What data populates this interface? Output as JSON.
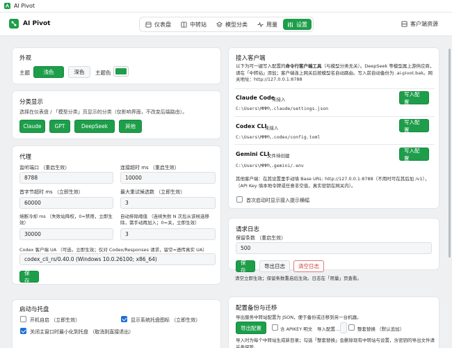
{
  "window": {
    "title": "AI Pivot"
  },
  "brand": {
    "name": "AI Pivot"
  },
  "nav": {
    "tabs": [
      {
        "label": "仪表盘",
        "icon": "dashboard-icon"
      },
      {
        "label": "中转站",
        "icon": "relay-icon"
      },
      {
        "label": "模型分类",
        "icon": "layers-icon"
      },
      {
        "label": "用量",
        "icon": "activity-icon"
      },
      {
        "label": "设置",
        "icon": "sliders-icon",
        "active": true
      }
    ]
  },
  "header_right": {
    "label": "客户端资源"
  },
  "appearance": {
    "title": "外观",
    "theme_label": "主题",
    "light": "浅色",
    "dark": "深色",
    "accent_label": "主题色",
    "accent_color": "#1e9e4a"
  },
  "categories": {
    "title": "分类显示",
    "desc": "选择在仪表盘 / 「模型分类」页显示的分类（仅影响界面，不改变后端路由）。",
    "items": [
      "Claude",
      "GPT",
      "DeepSeek",
      "其他"
    ]
  },
  "proxy": {
    "title": "代理",
    "port_label": "监听端口 （重启生效）",
    "port_value": "8788",
    "connect_timeout_label": "连接超时 ms （重启生效）",
    "connect_timeout_value": "10000",
    "first_byte_label": "首字节超时 ms （立即生效）",
    "first_byte_value": "60000",
    "max_retry_label": "最大重试候选数 （立即生效）",
    "max_retry_value": "3",
    "breaker_label": "熔断冷却 ms （失败站降权，0=禁用，立即生效）",
    "breaker_value": "30000",
    "auto_remove_label": "自动排除阈值 （连续失败 N 次后从该候选移除，需手动再加入；0=关，立即生效）",
    "auto_remove_value": "3",
    "ua_label": "Codex 客户端 UA （可选，立即生效；仅对 Codex/Responses 请求，留空=透传真实 UA）",
    "ua_value": "codex_cli_rs/0.40.0 (Windows 10.0.26100; x86_64)",
    "save": "保存"
  },
  "startup": {
    "title": "启动与托盘",
    "autostart": "开机自启 （立即生效）",
    "autostart_checked": false,
    "tray_icon": "显示系统托盘图标 （立即生效）",
    "tray_icon_checked": true,
    "close_minimize": "关闭主窗口时最小化到托盘 （取消则直接退出）",
    "close_minimize_checked": true
  },
  "clients": {
    "title": "接入客户端",
    "desc_1": "以下为可一键写入配置的",
    "desc_bold": "命令行客户端工具",
    "desc_2": "（与模型分类无关）。DeepSeek 等模型属上游供应商，请在「中转站」添加；客户端连上网关后按模型名自动路由。写入前自动备份为 .ai-pivot.bak。网关地址：http://127.0.0.1:8788",
    "items": [
      {
        "name": "Claude Code",
        "status": "未接入",
        "path": "C:\\Users\\MMM\\.claude/settings.json",
        "button": "写入配置"
      },
      {
        "name": "Codex CLI",
        "status": "未接入",
        "path": "C:\\Users\\MMM\\.codex/config.toml",
        "button": "写入配置"
      },
      {
        "name": "Gemini CLI",
        "status": "文件待创建",
        "path": "C:\\Users\\MMM\\.gemini/.env",
        "button": "写入配置"
      }
    ],
    "other_note": "其他客户端：在其设置里手动填 Base URL: http://127.0.0.1:8788（不用时可在其后加 /v1），（API Key 填本地令牌或任意非空值，真实密钥在网关内）。",
    "first_start": "首次启动时显示接入提示横幅",
    "first_start_checked": false
  },
  "logs": {
    "title": "请求日志",
    "retain_label": "保留条数 （重启生效）",
    "retain_value": "500",
    "save": "保存",
    "export": "导出日志",
    "clear": "清空日志",
    "note": "清空立即生效；保留条数重启后生效。日志在「用量」页查看。"
  },
  "backup": {
    "title": "配置备份与迁移",
    "desc": "导出服务中转站配置为 JSON，便于备份或迁移到另一台机器。",
    "export": "导出配置",
    "include_key": "含 APIKEY 明文",
    "import_label": "导入配置…",
    "replace": "整套替换 （默认追加）",
    "note": "导入时为每个中转站生成新目录；勾选「整套替换」会删除现有中转站与设置，含密钥的导出文件请妥善保管。"
  }
}
